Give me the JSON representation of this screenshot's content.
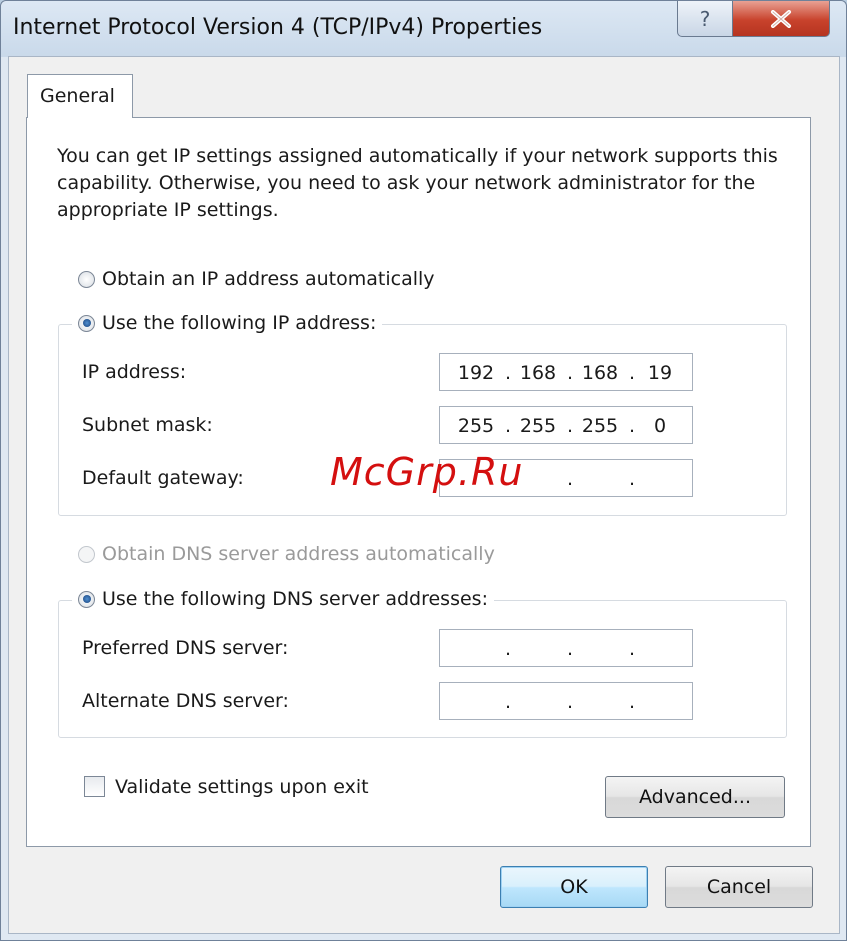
{
  "window": {
    "title": "Internet Protocol Version 4 (TCP/IPv4) Properties",
    "help_glyph": "?",
    "close_glyph": "X"
  },
  "tabs": [
    {
      "label": "General",
      "selected": true
    }
  ],
  "description": "You can get IP settings assigned automatically if your network supports this capability. Otherwise, you need to ask your network administrator for the appropriate IP settings.",
  "ip_mode": {
    "auto_label": "Obtain an IP address automatically",
    "manual_label": "Use the following IP address:",
    "selected": "manual"
  },
  "ip_fields": {
    "ip_address": {
      "label": "IP address:",
      "octets": [
        "192",
        "168",
        "168",
        "19"
      ]
    },
    "subnet_mask": {
      "label": "Subnet mask:",
      "octets": [
        "255",
        "255",
        "255",
        "0"
      ]
    },
    "default_gateway": {
      "label": "Default gateway:",
      "octets": [
        "",
        "",
        "",
        ""
      ]
    }
  },
  "dns_mode": {
    "auto_label": "Obtain DNS server address automatically",
    "auto_disabled": true,
    "manual_label": "Use the following DNS server addresses:",
    "selected": "manual"
  },
  "dns_fields": {
    "preferred": {
      "label": "Preferred DNS server:",
      "octets": [
        "",
        "",
        "",
        ""
      ]
    },
    "alternate": {
      "label": "Alternate DNS server:",
      "octets": [
        "",
        "",
        "",
        ""
      ]
    }
  },
  "validate": {
    "label": "Validate settings upon exit",
    "checked": false
  },
  "buttons": {
    "advanced": "Advanced...",
    "ok": "OK",
    "cancel": "Cancel"
  },
  "watermark": "McGrp.Ru",
  "colors": {
    "close_button": "#c8422c",
    "default_button_border": "#3c7fb1",
    "watermark": "#d40f0f"
  }
}
